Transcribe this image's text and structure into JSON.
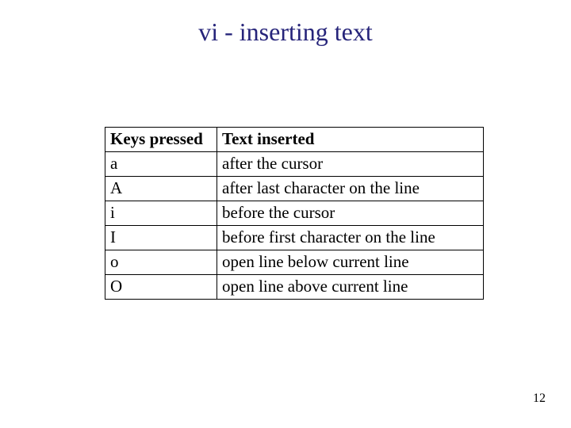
{
  "title": "vi - inserting text",
  "page_number": "12",
  "table": {
    "headers": {
      "key": "Keys pressed",
      "text": "Text inserted"
    },
    "rows": [
      {
        "key": "a",
        "text": "after the cursor"
      },
      {
        "key": "A",
        "text": "after last character on the line"
      },
      {
        "key": "i",
        "text": "before the cursor"
      },
      {
        "key": "I",
        "text": "before first character on the line"
      },
      {
        "key": "o",
        "text": "open line below current line"
      },
      {
        "key": "O",
        "text": "open line above current line"
      }
    ]
  }
}
